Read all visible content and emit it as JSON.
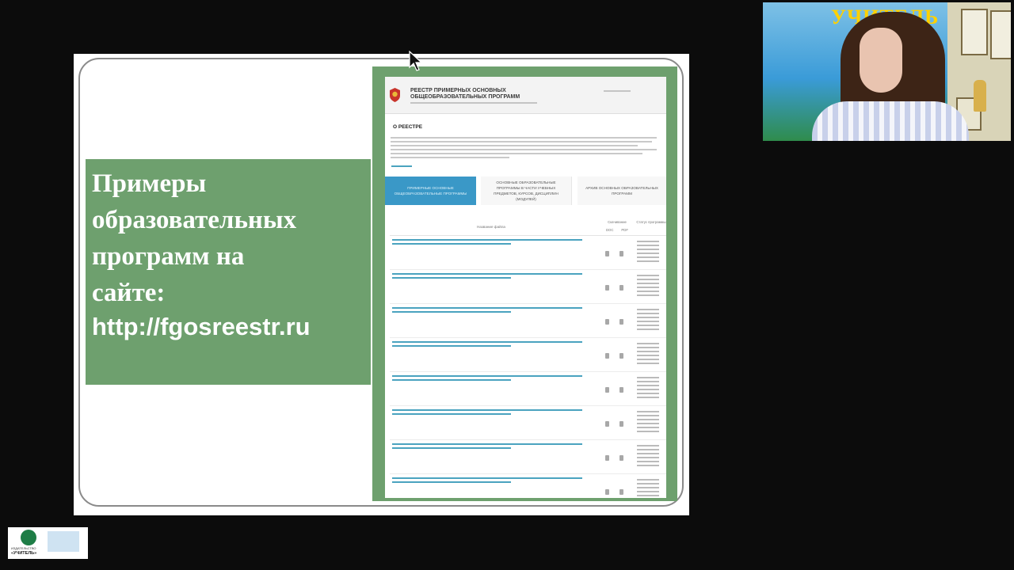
{
  "slide": {
    "heading": "Примеры\nобразовательных\nпрограмм на\nсайте:",
    "url": "http://fgosreestr.ru"
  },
  "embedded_site": {
    "title": "РЕЕСТР ПРИМЕРНЫХ ОСНОВНЫХ ОБЩЕОБРАЗОВАТЕЛЬНЫХ ПРОГРАММ",
    "section_title": "О РЕЕСТРЕ",
    "tabs": [
      {
        "label": "ПРИМЕРНЫЕ ОСНОВНЫЕ ОБЩЕОБРАЗОВАТЕЛЬНЫЕ ПРОГРАММЫ"
      },
      {
        "label": "ОСНОВНЫЕ ОБРАЗОВАТЕЛЬНЫЕ ПРОГРАММЫ В ЧАСТИ УЧЕБНЫХ ПРЕДМЕТОВ, КУРСОВ, ДИСЦИПЛИН (МОДУЛЕЙ)"
      },
      {
        "label": "АРХИВ ОСНОВНЫХ ОБРАЗОВАТЕЛЬНЫХ ПРОГРАММ"
      }
    ],
    "table": {
      "col_name": "Название файла",
      "col_files": "Скачивание",
      "col_doc": "DOC",
      "col_pdf": "PDF",
      "col_status": "Статус программы",
      "rows": [
        {},
        {},
        {},
        {},
        {},
        {},
        {},
        {}
      ]
    }
  },
  "webcam": {
    "banner_text": "УЧИТЕЛЬ"
  },
  "logo": {
    "line1": "ИЗДАТЕЛЬСТВО",
    "line2": "«УЧИТЕЛЬ»"
  },
  "colors": {
    "slide_green": "#6ea06e",
    "tab_active": "#3a98c7",
    "link": "#4aa3bf"
  }
}
